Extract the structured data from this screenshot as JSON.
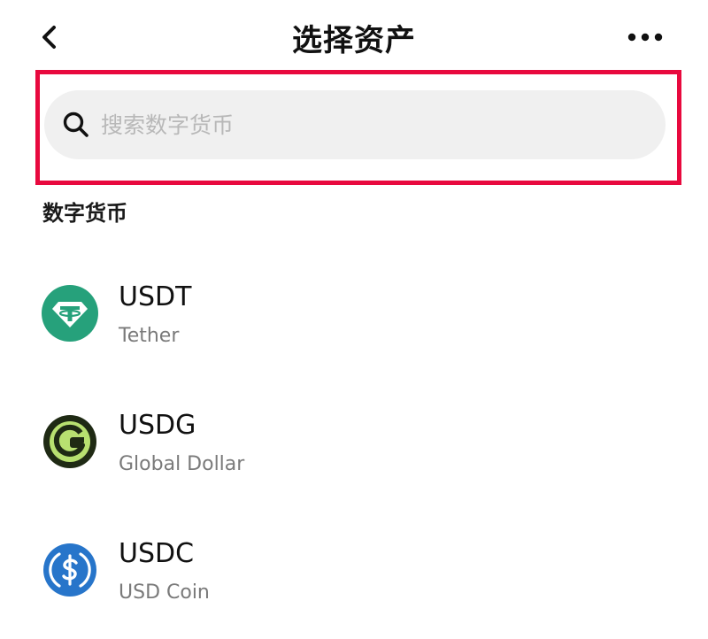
{
  "header": {
    "title": "选择资产",
    "back_icon": "chevron-left-icon",
    "more_icon": "more-horizontal-icon"
  },
  "search": {
    "placeholder": "搜索数字货币",
    "value": "",
    "icon": "search-icon"
  },
  "section": {
    "label": "数字货币"
  },
  "assets": [
    {
      "symbol": "USDT",
      "name": "Tether",
      "logo": "tether-logo",
      "color": "#26a17b"
    },
    {
      "symbol": "USDG",
      "name": "Global Dollar",
      "logo": "global-dollar-logo",
      "color": "#1f2a14"
    },
    {
      "symbol": "USDC",
      "name": "USD Coin",
      "logo": "usd-coin-logo",
      "color": "#2775ca"
    }
  ],
  "colors": {
    "highlight": "#e8093e",
    "search_bg": "#f0f0f0",
    "subtext": "#7a7a7a"
  }
}
